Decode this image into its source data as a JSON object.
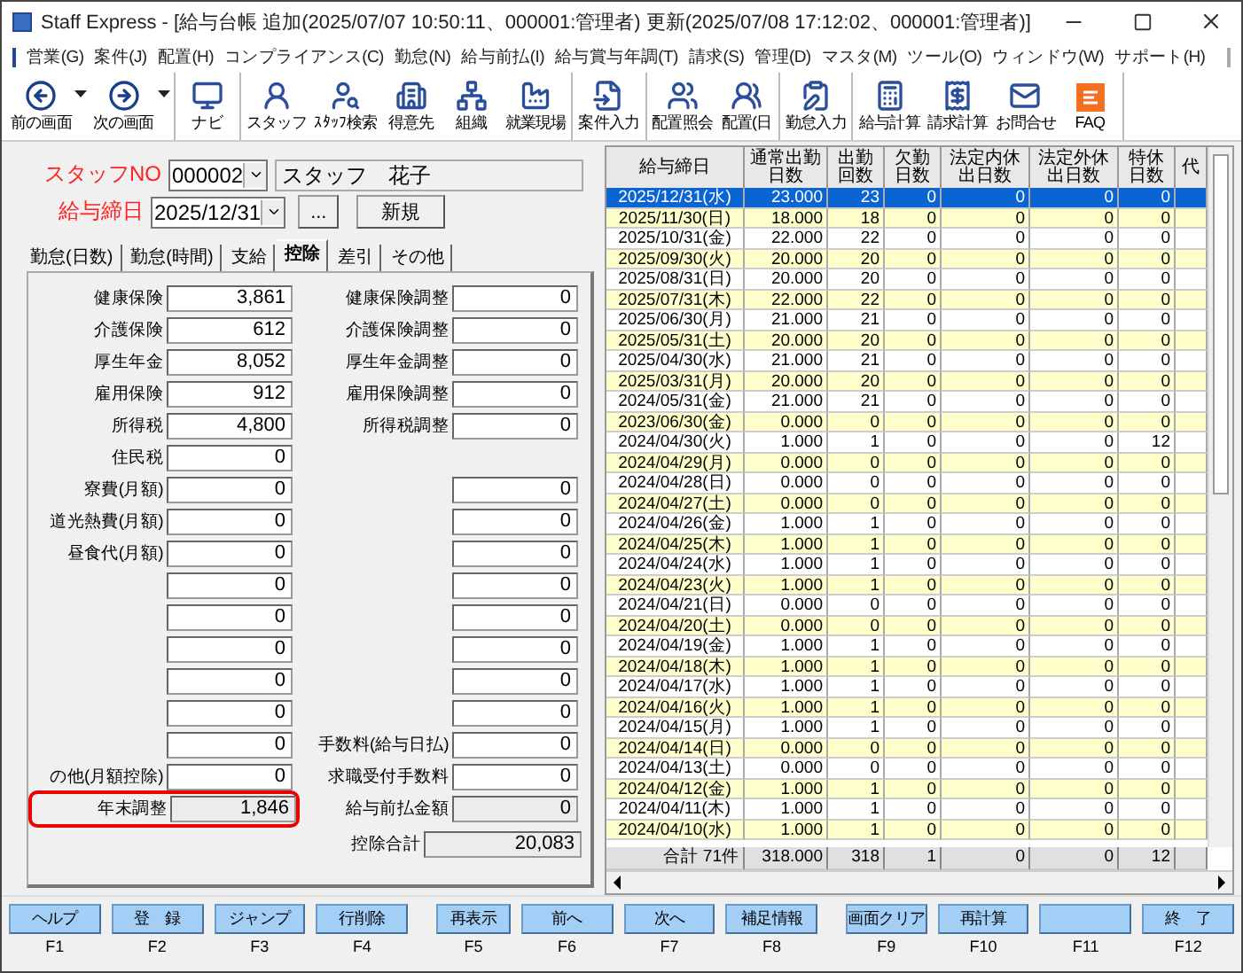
{
  "window": {
    "title": "Staff Express - [給与台帳  追加(2025/07/07 10:50:11、000001:管理者)  更新(2025/07/08 17:12:02、000001:管理者)]"
  },
  "menu": [
    "営業(G)",
    "案件(J)",
    "配置(H)",
    "コンプライアンス(C)",
    "勤怠(N)",
    "給与前払(I)",
    "給与賞与年調(T)",
    "請求(S)",
    "管理(D)",
    "マスタ(M)",
    "ツール(O)",
    "ウィンドウ(W)",
    "サポート(H)"
  ],
  "toolbar_groups": [
    {
      "items": [
        {
          "label": "前の画面",
          "dropdown": true
        },
        {
          "label": "次の画面",
          "dropdown": true
        }
      ]
    },
    {
      "items": [
        {
          "label": "ナビ",
          "dropdown": false
        }
      ]
    },
    {
      "items": [
        {
          "label": "スタッフ",
          "dropdown": false
        },
        {
          "label": "ｽﾀｯﾌ検索",
          "dropdown": false
        },
        {
          "label": "得意先",
          "dropdown": false
        },
        {
          "label": "組織",
          "dropdown": false
        },
        {
          "label": "就業現場",
          "dropdown": false
        }
      ]
    },
    {
      "items": [
        {
          "label": "案件入力",
          "dropdown": false
        }
      ]
    },
    {
      "items": [
        {
          "label": "配置照会",
          "dropdown": false
        },
        {
          "label": "配置(日",
          "dropdown": false
        }
      ]
    },
    {
      "items": [
        {
          "label": "勤怠入力",
          "dropdown": false
        }
      ]
    },
    {
      "items": [
        {
          "label": "給与計算",
          "dropdown": false
        },
        {
          "label": "請求計算",
          "dropdown": false
        },
        {
          "label": "お問合せ",
          "dropdown": false
        },
        {
          "label": "FAQ",
          "dropdown": false
        }
      ]
    }
  ],
  "staff": {
    "label": "スタッフNO",
    "number": "000002",
    "name": "スタッフ　花子"
  },
  "pay_date": {
    "label": "給与締日",
    "value": "2025/12/31",
    "browse_button": "...",
    "new_button": "新規"
  },
  "tabs": [
    {
      "label": "勤怠(日数)",
      "selected": false
    },
    {
      "label": "勤怠(時間)",
      "selected": false
    },
    {
      "label": "支給",
      "selected": false
    },
    {
      "label": "控除",
      "selected": true
    },
    {
      "label": "差引",
      "selected": false
    },
    {
      "label": "その他",
      "selected": false
    }
  ],
  "deductions": [
    {
      "left": {
        "label": "健康保険",
        "value": "3,861",
        "readonly": false,
        "highlighted": false
      },
      "right": {
        "label": "健康保険調整",
        "value": "0",
        "readonly": false
      }
    },
    {
      "left": {
        "label": "介護保険",
        "value": "612",
        "readonly": false,
        "highlighted": false
      },
      "right": {
        "label": "介護保険調整",
        "value": "0",
        "readonly": false
      }
    },
    {
      "left": {
        "label": "厚生年金",
        "value": "8,052",
        "readonly": false,
        "highlighted": false
      },
      "right": {
        "label": "厚生年金調整",
        "value": "0",
        "readonly": false
      }
    },
    {
      "left": {
        "label": "雇用保険",
        "value": "912",
        "readonly": false,
        "highlighted": false
      },
      "right": {
        "label": "雇用保険調整",
        "value": "0",
        "readonly": false
      }
    },
    {
      "left": {
        "label": "所得税",
        "value": "4,800",
        "readonly": false,
        "highlighted": false
      },
      "right": {
        "label": "所得税調整",
        "value": "0",
        "readonly": false
      }
    },
    {
      "left": {
        "label": "住民税",
        "value": "0",
        "readonly": false,
        "highlighted": false
      }
    },
    {
      "left": {
        "label": "寮費(月額)",
        "value": "0",
        "readonly": false,
        "highlighted": false
      },
      "right": {
        "value": "0",
        "readonly": false
      }
    },
    {
      "left": {
        "label": "道光熱費(月額)",
        "value": "0",
        "readonly": false,
        "highlighted": false
      },
      "right": {
        "value": "0",
        "readonly": false
      }
    },
    {
      "left": {
        "label": "昼食代(月額)",
        "value": "0",
        "readonly": false,
        "highlighted": false
      },
      "right": {
        "value": "0",
        "readonly": false
      }
    },
    {
      "left": {
        "value": "0",
        "readonly": false,
        "highlighted": false
      },
      "right": {
        "value": "0",
        "readonly": false
      }
    },
    {
      "left": {
        "value": "0",
        "readonly": false,
        "highlighted": false
      },
      "right": {
        "value": "0",
        "readonly": false
      }
    },
    {
      "left": {
        "value": "0",
        "readonly": false,
        "highlighted": false
      },
      "right": {
        "value": "0",
        "readonly": false
      }
    },
    {
      "left": {
        "value": "0",
        "readonly": false,
        "highlighted": false
      },
      "right": {
        "value": "0",
        "readonly": false
      }
    },
    {
      "left": {
        "value": "0",
        "readonly": false,
        "highlighted": false
      },
      "right": {
        "value": "0",
        "readonly": false
      }
    },
    {
      "left": {
        "value": "0",
        "readonly": false,
        "highlighted": false
      },
      "right": {
        "label": "手数料(給与日払)",
        "value": "0",
        "readonly": false
      }
    },
    {
      "left": {
        "label": "の他(月額控除)",
        "value": "0",
        "readonly": false,
        "highlighted": false
      },
      "right": {
        "label": "求職受付手数料",
        "value": "0",
        "readonly": false
      }
    },
    {
      "left": {
        "label": "年末調整",
        "value": "1,846",
        "readonly": true,
        "highlighted": true
      },
      "right": {
        "label": "給与前払金額",
        "value": "0",
        "readonly": true
      }
    }
  ],
  "total": {
    "label": "控除合計",
    "value": "20,083"
  },
  "table": {
    "columns": [
      {
        "lines": [
          "給与締日"
        ]
      },
      {
        "lines": [
          "通常出勤",
          "日数"
        ]
      },
      {
        "lines": [
          "出勤",
          "回数"
        ]
      },
      {
        "lines": [
          "欠勤",
          "日数"
        ]
      },
      {
        "lines": [
          "法定内休",
          "出日数"
        ]
      },
      {
        "lines": [
          "法定外休",
          "出日数"
        ]
      },
      {
        "lines": [
          "特休",
          "日数"
        ]
      },
      {
        "lines": [
          "代"
        ]
      }
    ],
    "rows": [
      {
        "selected": true,
        "cells": [
          "2025/12/31(水)",
          "23.000",
          "23",
          "0",
          "0",
          "0",
          "0"
        ]
      },
      {
        "selected": false,
        "cells": [
          "2025/11/30(日)",
          "18.000",
          "18",
          "0",
          "0",
          "0",
          "0"
        ]
      },
      {
        "selected": false,
        "cells": [
          "2025/10/31(金)",
          "22.000",
          "22",
          "0",
          "0",
          "0",
          "0"
        ]
      },
      {
        "selected": false,
        "cells": [
          "2025/09/30(火)",
          "20.000",
          "20",
          "0",
          "0",
          "0",
          "0"
        ]
      },
      {
        "selected": false,
        "cells": [
          "2025/08/31(日)",
          "20.000",
          "20",
          "0",
          "0",
          "0",
          "0"
        ]
      },
      {
        "selected": false,
        "cells": [
          "2025/07/31(木)",
          "22.000",
          "22",
          "0",
          "0",
          "0",
          "0"
        ]
      },
      {
        "selected": false,
        "cells": [
          "2025/06/30(月)",
          "21.000",
          "21",
          "0",
          "0",
          "0",
          "0"
        ]
      },
      {
        "selected": false,
        "cells": [
          "2025/05/31(土)",
          "20.000",
          "20",
          "0",
          "0",
          "0",
          "0"
        ]
      },
      {
        "selected": false,
        "cells": [
          "2025/04/30(水)",
          "21.000",
          "21",
          "0",
          "0",
          "0",
          "0"
        ]
      },
      {
        "selected": false,
        "cells": [
          "2025/03/31(月)",
          "20.000",
          "20",
          "0",
          "0",
          "0",
          "0"
        ]
      },
      {
        "selected": false,
        "cells": [
          "2024/05/31(金)",
          "21.000",
          "21",
          "0",
          "0",
          "0",
          "0"
        ]
      },
      {
        "selected": false,
        "cells": [
          "2023/06/30(金)",
          "0.000",
          "0",
          "0",
          "0",
          "0",
          "0"
        ]
      },
      {
        "selected": false,
        "cells": [
          "2024/04/30(火)",
          "1.000",
          "1",
          "0",
          "0",
          "0",
          "12"
        ]
      },
      {
        "selected": false,
        "cells": [
          "2024/04/29(月)",
          "0.000",
          "0",
          "0",
          "0",
          "0",
          "0"
        ]
      },
      {
        "selected": false,
        "cells": [
          "2024/04/28(日)",
          "0.000",
          "0",
          "0",
          "0",
          "0",
          "0"
        ]
      },
      {
        "selected": false,
        "cells": [
          "2024/04/27(土)",
          "0.000",
          "0",
          "0",
          "0",
          "0",
          "0"
        ]
      },
      {
        "selected": false,
        "cells": [
          "2024/04/26(金)",
          "1.000",
          "1",
          "0",
          "0",
          "0",
          "0"
        ]
      },
      {
        "selected": false,
        "cells": [
          "2024/04/25(木)",
          "1.000",
          "1",
          "0",
          "0",
          "0",
          "0"
        ]
      },
      {
        "selected": false,
        "cells": [
          "2024/04/24(水)",
          "1.000",
          "1",
          "0",
          "0",
          "0",
          "0"
        ]
      },
      {
        "selected": false,
        "cells": [
          "2024/04/23(火)",
          "1.000",
          "1",
          "0",
          "0",
          "0",
          "0"
        ]
      },
      {
        "selected": false,
        "cells": [
          "2024/04/21(日)",
          "0.000",
          "0",
          "0",
          "0",
          "0",
          "0"
        ]
      },
      {
        "selected": false,
        "cells": [
          "2024/04/20(土)",
          "0.000",
          "0",
          "0",
          "0",
          "0",
          "0"
        ]
      },
      {
        "selected": false,
        "cells": [
          "2024/04/19(金)",
          "1.000",
          "1",
          "0",
          "0",
          "0",
          "0"
        ]
      },
      {
        "selected": false,
        "cells": [
          "2024/04/18(木)",
          "1.000",
          "1",
          "0",
          "0",
          "0",
          "0"
        ]
      },
      {
        "selected": false,
        "cells": [
          "2024/04/17(水)",
          "1.000",
          "1",
          "0",
          "0",
          "0",
          "0"
        ]
      },
      {
        "selected": false,
        "cells": [
          "2024/04/16(火)",
          "1.000",
          "1",
          "0",
          "0",
          "0",
          "0"
        ]
      },
      {
        "selected": false,
        "cells": [
          "2024/04/15(月)",
          "1.000",
          "1",
          "0",
          "0",
          "0",
          "0"
        ]
      },
      {
        "selected": false,
        "cells": [
          "2024/04/14(日)",
          "0.000",
          "0",
          "0",
          "0",
          "0",
          "0"
        ]
      },
      {
        "selected": false,
        "cells": [
          "2024/04/13(土)",
          "0.000",
          "0",
          "0",
          "0",
          "0",
          "0"
        ]
      },
      {
        "selected": false,
        "cells": [
          "2024/04/12(金)",
          "1.000",
          "1",
          "0",
          "0",
          "0",
          "0"
        ]
      },
      {
        "selected": false,
        "cells": [
          "2024/04/11(木)",
          "1.000",
          "1",
          "0",
          "0",
          "0",
          "0"
        ]
      },
      {
        "selected": false,
        "cells": [
          "2024/04/10(水)",
          "1.000",
          "1",
          "0",
          "0",
          "0",
          "0"
        ]
      }
    ],
    "totals": [
      "合計 71件",
      "318.000",
      "318",
      "1",
      "0",
      "0",
      "12"
    ]
  },
  "function_keys": [
    {
      "label": "ヘルプ",
      "key": "F1"
    },
    {
      "label": "登　録",
      "key": "F2"
    },
    {
      "label": "ジャンプ",
      "key": "F3"
    },
    {
      "label": "行削除",
      "key": "F4"
    },
    {
      "label": "再表示",
      "key": "F5"
    },
    {
      "label": "前へ",
      "key": "F6"
    },
    {
      "label": "次へ",
      "key": "F7"
    },
    {
      "label": "補足情報",
      "key": "F8"
    },
    {
      "label": "画面クリア",
      "key": "F9"
    },
    {
      "label": "再計算",
      "key": "F10"
    },
    {
      "key": "F11"
    },
    {
      "label": "終　了",
      "key": "F12"
    }
  ]
}
